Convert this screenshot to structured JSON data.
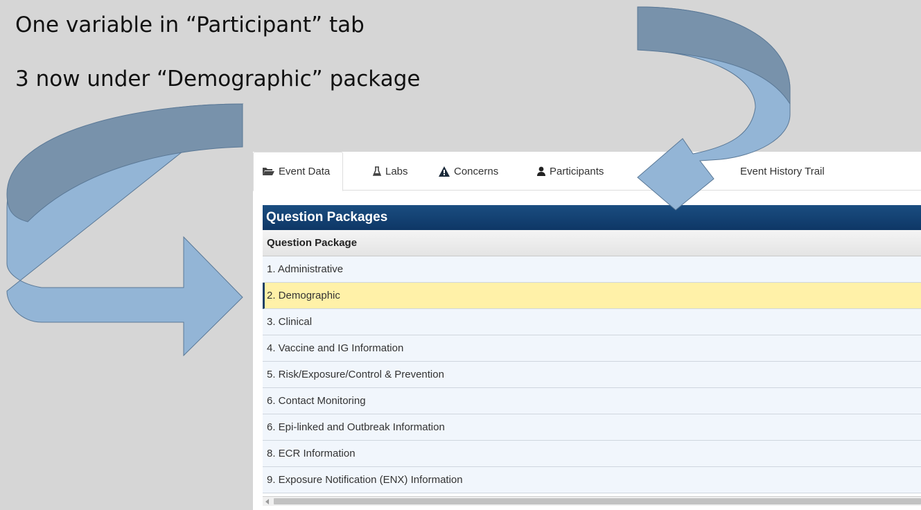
{
  "slide": {
    "line1": "One variable in “Participant” tab",
    "line2": "3 now under “Demographic” package"
  },
  "tabs": [
    {
      "label": "Event Data",
      "icon": "folder-open-icon",
      "active": true
    },
    {
      "label": "Labs",
      "icon": "flask-icon",
      "active": false
    },
    {
      "label": "Concerns",
      "icon": "warning-icon",
      "active": false
    },
    {
      "label": "Participants",
      "icon": "user-icon",
      "active": false
    },
    {
      "label": "Event History Trail",
      "icon": "",
      "active": false
    }
  ],
  "question_packages": {
    "title": "Question Packages",
    "column_header": "Question Package",
    "rows": [
      "1. Administrative",
      "2. Demographic",
      "3. Clinical",
      "4. Vaccine and IG Information",
      "5. Risk/Exposure/Control & Prevention",
      "6. Contact Monitoring",
      "6. Epi-linked and Outbreak Information",
      "8. ECR Information",
      "9. Exposure Notification (ENX) Information"
    ],
    "selected_index": 1
  },
  "colors": {
    "header_blue": "#0e3766",
    "row_bg": "#f1f6fc",
    "selected_bg": "#fff1a8",
    "arrow_light": "#93b5d6",
    "arrow_dark": "#7892ab"
  }
}
